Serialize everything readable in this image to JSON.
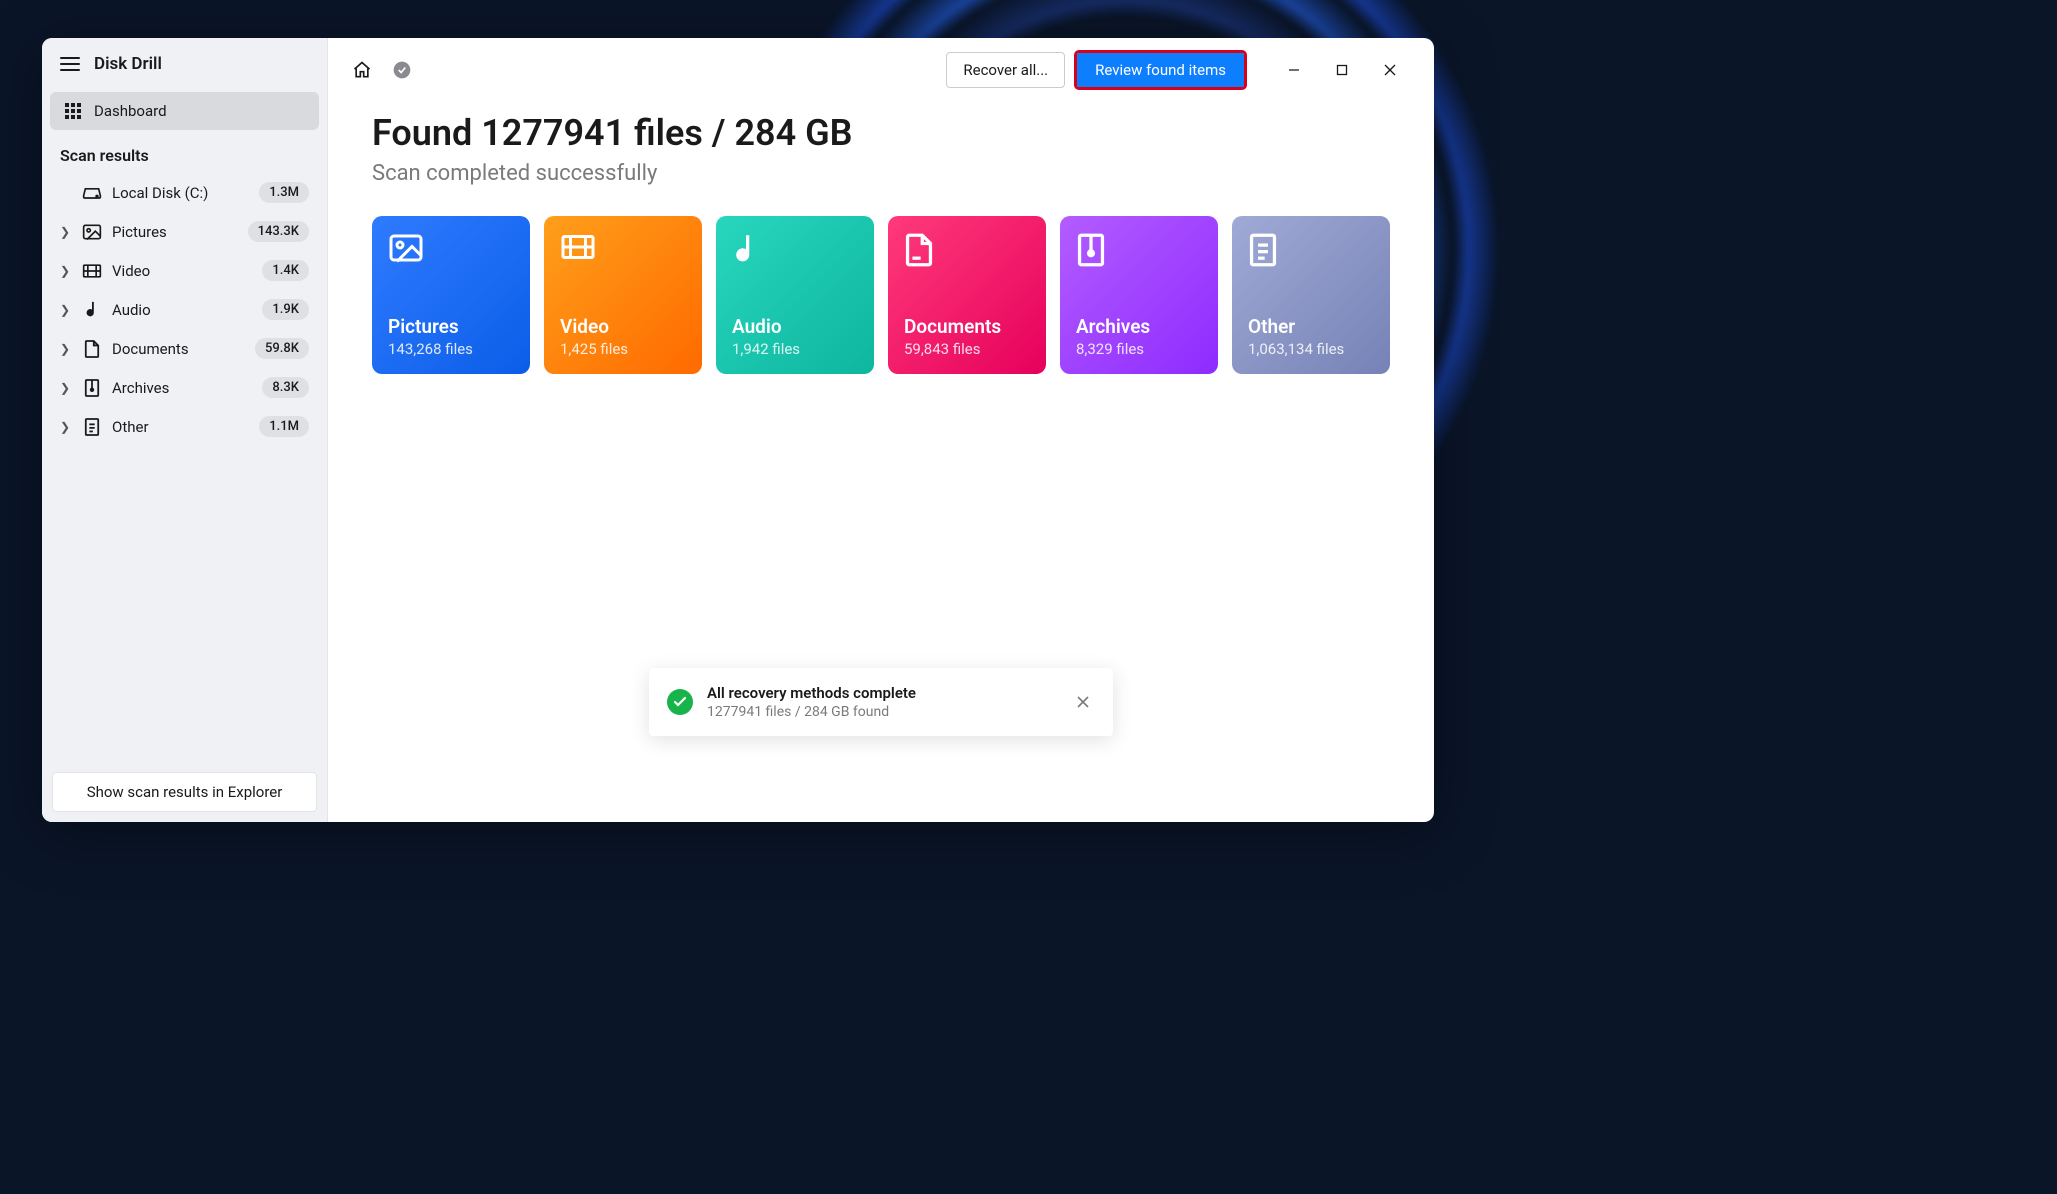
{
  "app": {
    "title": "Disk Drill"
  },
  "sidebar": {
    "dashboard_label": "Dashboard",
    "section_title": "Scan results",
    "items": [
      {
        "label": "Local Disk (C:)",
        "badge": "1.3M",
        "has_chev": false,
        "icon": "hdd"
      },
      {
        "label": "Pictures",
        "badge": "143.3K",
        "has_chev": true,
        "icon": "image"
      },
      {
        "label": "Video",
        "badge": "1.4K",
        "has_chev": true,
        "icon": "video"
      },
      {
        "label": "Audio",
        "badge": "1.9K",
        "has_chev": true,
        "icon": "audio"
      },
      {
        "label": "Documents",
        "badge": "59.8K",
        "has_chev": true,
        "icon": "doc"
      },
      {
        "label": "Archives",
        "badge": "8.3K",
        "has_chev": true,
        "icon": "archive"
      },
      {
        "label": "Other",
        "badge": "1.1M",
        "has_chev": true,
        "icon": "other"
      }
    ],
    "footer_button": "Show scan results in Explorer"
  },
  "toolbar": {
    "recover_all": "Recover all...",
    "review": "Review found items"
  },
  "content": {
    "headline": "Found 1277941 files / 284 GB",
    "subhead": "Scan completed successfully",
    "cards": [
      {
        "title": "Pictures",
        "sub": "143,268 files",
        "class": "card-pictures",
        "icon": "image"
      },
      {
        "title": "Video",
        "sub": "1,425 files",
        "class": "card-video",
        "icon": "video"
      },
      {
        "title": "Audio",
        "sub": "1,942 files",
        "class": "card-audio",
        "icon": "audio"
      },
      {
        "title": "Documents",
        "sub": "59,843 files",
        "class": "card-documents",
        "icon": "doc"
      },
      {
        "title": "Archives",
        "sub": "8,329 files",
        "class": "card-archives",
        "icon": "archive"
      },
      {
        "title": "Other",
        "sub": "1,063,134 files",
        "class": "card-other",
        "icon": "other"
      }
    ]
  },
  "toast": {
    "title": "All recovery methods complete",
    "sub": "1277941 files / 284 GB found"
  }
}
